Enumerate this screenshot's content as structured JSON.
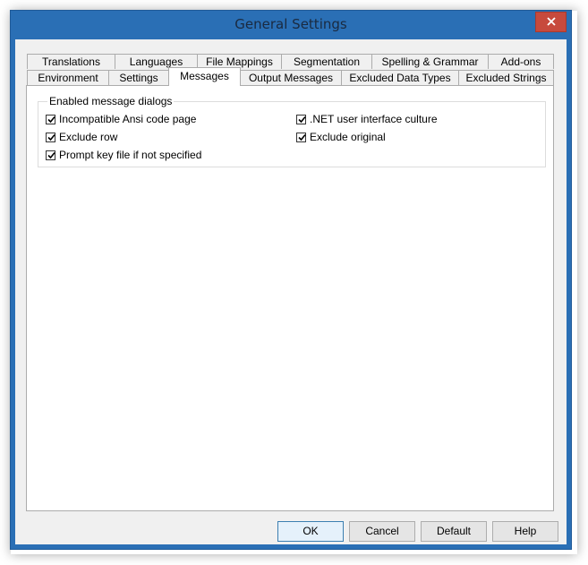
{
  "window": {
    "title": "General Settings",
    "accent_color": "#2a6fb5",
    "close_icon": "close-icon"
  },
  "tabs": {
    "row_back": [
      "Translations",
      "Languages",
      "File Mappings",
      "Segmentation",
      "Spelling & Grammar",
      "Add-ons"
    ],
    "row_front": [
      "Environment",
      "Settings",
      "Messages",
      "Output Messages",
      "Excluded Data Types",
      "Excluded Strings"
    ],
    "active": "Messages"
  },
  "messages": {
    "group_label": "Enabled message dialogs",
    "options": [
      {
        "label": "Incompatible Ansi code page",
        "checked": true
      },
      {
        "label": "Exclude row",
        "checked": true
      },
      {
        "label": "Prompt key file if not specified",
        "checked": true
      },
      {
        "label": ".NET user interface culture",
        "checked": true
      },
      {
        "label": "Exclude original",
        "checked": true
      }
    ]
  },
  "buttons": {
    "ok": "OK",
    "cancel": "Cancel",
    "default": "Default",
    "help": "Help"
  }
}
